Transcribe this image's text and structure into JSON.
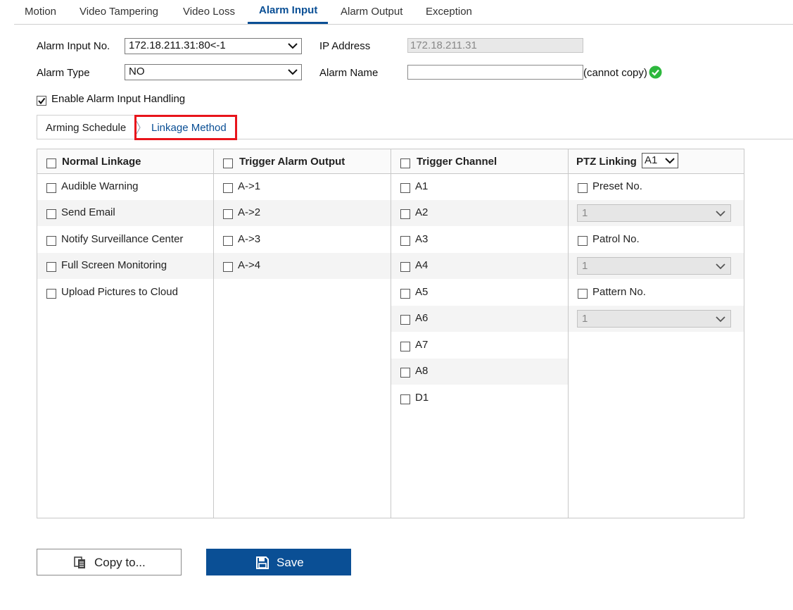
{
  "top_tabs": {
    "items": [
      "Motion",
      "Video Tampering",
      "Video Loss",
      "Alarm Input",
      "Alarm Output",
      "Exception"
    ],
    "active": "Alarm Input"
  },
  "form": {
    "alarm_input_no_label": "Alarm Input No.",
    "alarm_input_no_value": "172.18.211.31:80<-1",
    "ip_address_label": "IP Address",
    "ip_address_value": "172.18.211.31",
    "alarm_type_label": "Alarm Type",
    "alarm_type_value": "NO",
    "alarm_name_label": "Alarm Name",
    "alarm_name_value": "",
    "cannot_copy_note": "(cannot copy)",
    "enable_handling_label": "Enable Alarm Input Handling",
    "enable_handling_checked": true
  },
  "sub_tabs": {
    "arming_schedule": "Arming Schedule",
    "linkage_method": "Linkage Method",
    "active": "Linkage Method"
  },
  "linkage": {
    "normal_linkage": {
      "header": "Normal Linkage",
      "items": [
        "Audible Warning",
        "Send Email",
        "Notify Surveillance Center",
        "Full Screen Monitoring",
        "Upload Pictures to Cloud"
      ]
    },
    "trigger_alarm_output": {
      "header": "Trigger Alarm Output",
      "items": [
        "A->1",
        "A->2",
        "A->3",
        "A->4"
      ]
    },
    "trigger_channel": {
      "header": "Trigger Channel",
      "items": [
        "A1",
        "A2",
        "A3",
        "A4",
        "A5",
        "A6",
        "A7",
        "A8",
        "D1"
      ]
    },
    "ptz_linking": {
      "header": "PTZ Linking",
      "channel_value": "A1",
      "preset_label": "Preset No.",
      "preset_value": "1",
      "patrol_label": "Patrol No.",
      "patrol_value": "1",
      "pattern_label": "Pattern No.",
      "pattern_value": "1"
    }
  },
  "buttons": {
    "copy_to": "Copy to...",
    "save": "Save"
  },
  "colors": {
    "accent": "#0a4f95",
    "highlight": "#e8141b",
    "ok": "#2db83d"
  },
  "icons": {
    "ok": "check-circle-icon",
    "copy": "copy-icon",
    "save": "floppy-disk-icon",
    "separator": "chevron-right-icon"
  }
}
